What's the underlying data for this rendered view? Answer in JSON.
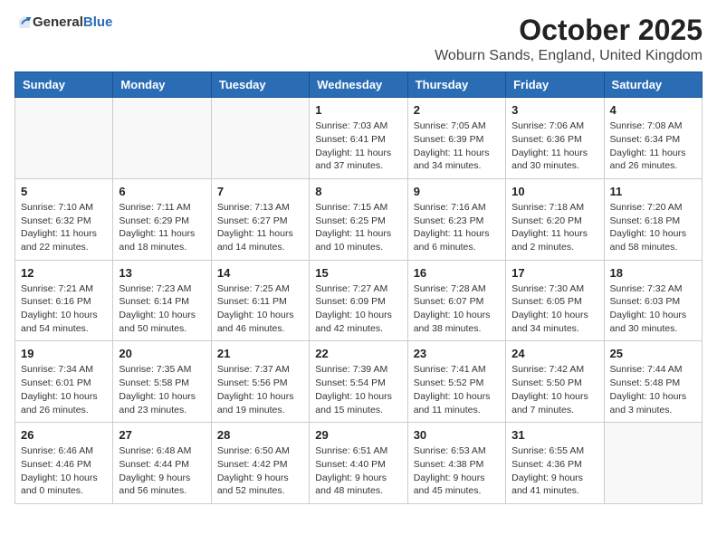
{
  "header": {
    "logo_general": "General",
    "logo_blue": "Blue",
    "month_title": "October 2025",
    "location": "Woburn Sands, England, United Kingdom"
  },
  "days_of_week": [
    "Sunday",
    "Monday",
    "Tuesday",
    "Wednesday",
    "Thursday",
    "Friday",
    "Saturday"
  ],
  "weeks": [
    [
      {
        "date": "",
        "info": ""
      },
      {
        "date": "",
        "info": ""
      },
      {
        "date": "",
        "info": ""
      },
      {
        "date": "1",
        "info": "Sunrise: 7:03 AM\nSunset: 6:41 PM\nDaylight: 11 hours\nand 37 minutes."
      },
      {
        "date": "2",
        "info": "Sunrise: 7:05 AM\nSunset: 6:39 PM\nDaylight: 11 hours\nand 34 minutes."
      },
      {
        "date": "3",
        "info": "Sunrise: 7:06 AM\nSunset: 6:36 PM\nDaylight: 11 hours\nand 30 minutes."
      },
      {
        "date": "4",
        "info": "Sunrise: 7:08 AM\nSunset: 6:34 PM\nDaylight: 11 hours\nand 26 minutes."
      }
    ],
    [
      {
        "date": "5",
        "info": "Sunrise: 7:10 AM\nSunset: 6:32 PM\nDaylight: 11 hours\nand 22 minutes."
      },
      {
        "date": "6",
        "info": "Sunrise: 7:11 AM\nSunset: 6:29 PM\nDaylight: 11 hours\nand 18 minutes."
      },
      {
        "date": "7",
        "info": "Sunrise: 7:13 AM\nSunset: 6:27 PM\nDaylight: 11 hours\nand 14 minutes."
      },
      {
        "date": "8",
        "info": "Sunrise: 7:15 AM\nSunset: 6:25 PM\nDaylight: 11 hours\nand 10 minutes."
      },
      {
        "date": "9",
        "info": "Sunrise: 7:16 AM\nSunset: 6:23 PM\nDaylight: 11 hours\nand 6 minutes."
      },
      {
        "date": "10",
        "info": "Sunrise: 7:18 AM\nSunset: 6:20 PM\nDaylight: 11 hours\nand 2 minutes."
      },
      {
        "date": "11",
        "info": "Sunrise: 7:20 AM\nSunset: 6:18 PM\nDaylight: 10 hours\nand 58 minutes."
      }
    ],
    [
      {
        "date": "12",
        "info": "Sunrise: 7:21 AM\nSunset: 6:16 PM\nDaylight: 10 hours\nand 54 minutes."
      },
      {
        "date": "13",
        "info": "Sunrise: 7:23 AM\nSunset: 6:14 PM\nDaylight: 10 hours\nand 50 minutes."
      },
      {
        "date": "14",
        "info": "Sunrise: 7:25 AM\nSunset: 6:11 PM\nDaylight: 10 hours\nand 46 minutes."
      },
      {
        "date": "15",
        "info": "Sunrise: 7:27 AM\nSunset: 6:09 PM\nDaylight: 10 hours\nand 42 minutes."
      },
      {
        "date": "16",
        "info": "Sunrise: 7:28 AM\nSunset: 6:07 PM\nDaylight: 10 hours\nand 38 minutes."
      },
      {
        "date": "17",
        "info": "Sunrise: 7:30 AM\nSunset: 6:05 PM\nDaylight: 10 hours\nand 34 minutes."
      },
      {
        "date": "18",
        "info": "Sunrise: 7:32 AM\nSunset: 6:03 PM\nDaylight: 10 hours\nand 30 minutes."
      }
    ],
    [
      {
        "date": "19",
        "info": "Sunrise: 7:34 AM\nSunset: 6:01 PM\nDaylight: 10 hours\nand 26 minutes."
      },
      {
        "date": "20",
        "info": "Sunrise: 7:35 AM\nSunset: 5:58 PM\nDaylight: 10 hours\nand 23 minutes."
      },
      {
        "date": "21",
        "info": "Sunrise: 7:37 AM\nSunset: 5:56 PM\nDaylight: 10 hours\nand 19 minutes."
      },
      {
        "date": "22",
        "info": "Sunrise: 7:39 AM\nSunset: 5:54 PM\nDaylight: 10 hours\nand 15 minutes."
      },
      {
        "date": "23",
        "info": "Sunrise: 7:41 AM\nSunset: 5:52 PM\nDaylight: 10 hours\nand 11 minutes."
      },
      {
        "date": "24",
        "info": "Sunrise: 7:42 AM\nSunset: 5:50 PM\nDaylight: 10 hours\nand 7 minutes."
      },
      {
        "date": "25",
        "info": "Sunrise: 7:44 AM\nSunset: 5:48 PM\nDaylight: 10 hours\nand 3 minutes."
      }
    ],
    [
      {
        "date": "26",
        "info": "Sunrise: 6:46 AM\nSunset: 4:46 PM\nDaylight: 10 hours\nand 0 minutes."
      },
      {
        "date": "27",
        "info": "Sunrise: 6:48 AM\nSunset: 4:44 PM\nDaylight: 9 hours\nand 56 minutes."
      },
      {
        "date": "28",
        "info": "Sunrise: 6:50 AM\nSunset: 4:42 PM\nDaylight: 9 hours\nand 52 minutes."
      },
      {
        "date": "29",
        "info": "Sunrise: 6:51 AM\nSunset: 4:40 PM\nDaylight: 9 hours\nand 48 minutes."
      },
      {
        "date": "30",
        "info": "Sunrise: 6:53 AM\nSunset: 4:38 PM\nDaylight: 9 hours\nand 45 minutes."
      },
      {
        "date": "31",
        "info": "Sunrise: 6:55 AM\nSunset: 4:36 PM\nDaylight: 9 hours\nand 41 minutes."
      },
      {
        "date": "",
        "info": ""
      }
    ]
  ]
}
